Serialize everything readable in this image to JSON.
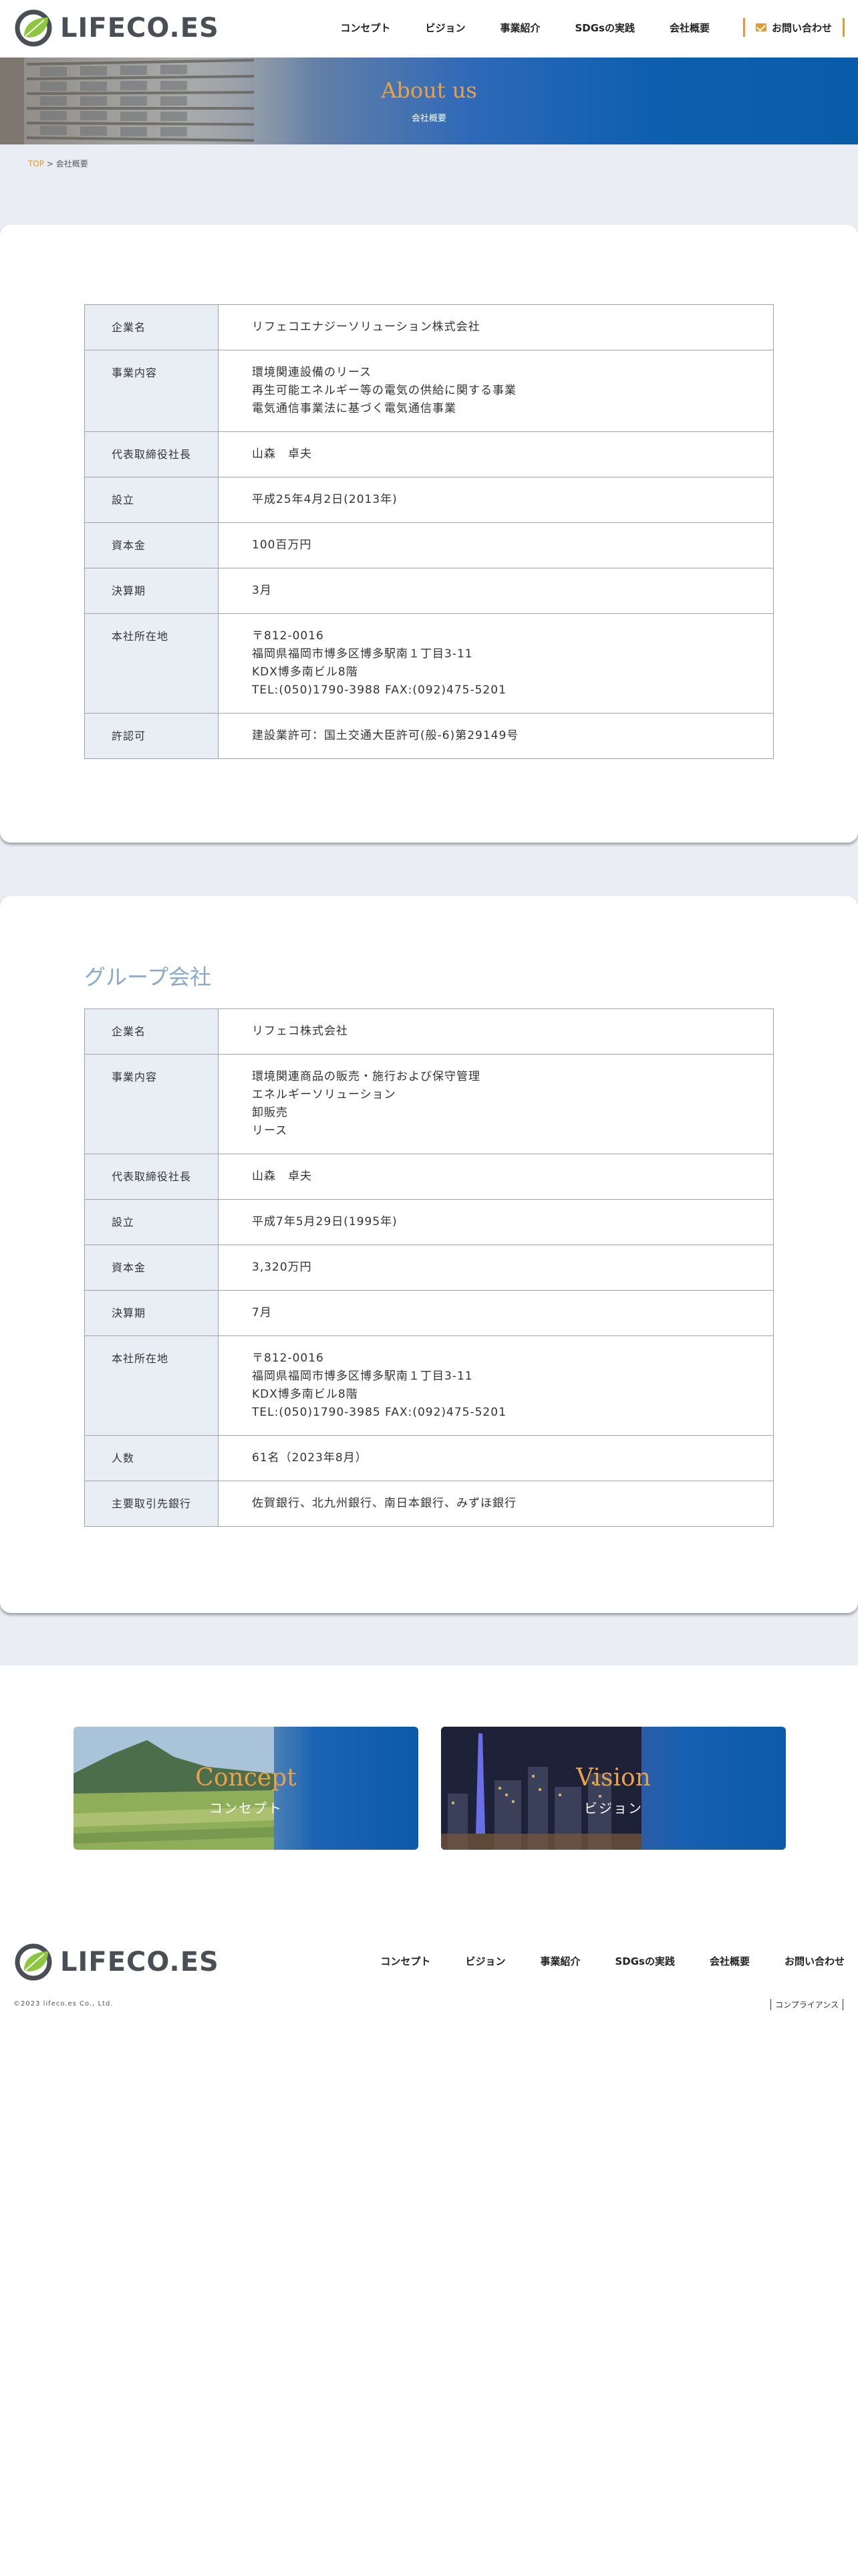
{
  "header": {
    "logo_text": "LIFECO.ES",
    "nav": [
      "コンセプト",
      "ビジョン",
      "事業紹介",
      "SDGsの実践",
      "会社概要"
    ],
    "contact_label": "お問い合わせ"
  },
  "hero": {
    "title": "About us",
    "subtitle": "会社概要"
  },
  "breadcrumb": {
    "top": "TOP",
    "separator": " > ",
    "current": "会社概要"
  },
  "company": {
    "rows": [
      {
        "label": "企業名",
        "value": "リフェコエナジーソリューション株式会社"
      },
      {
        "label": "事業内容",
        "value": [
          "環境関連設備のリース",
          "再生可能エネルギー等の電気の供給に関する事業",
          "電気通信事業法に基づく電気通信事業"
        ]
      },
      {
        "label": "代表取締役社長",
        "value": "山森　卓夫"
      },
      {
        "label": "設立",
        "value": "平成25年4月2日(2013年)"
      },
      {
        "label": "資本金",
        "value": "100百万円"
      },
      {
        "label": "決算期",
        "value": "3月"
      },
      {
        "label": "本社所在地",
        "value": [
          "〒812-0016",
          "福岡県福岡市博多区博多駅南１丁目3-11",
          "KDX博多南ビル8階",
          "TEL:(050)1790-3988 FAX:(092)475-5201"
        ]
      },
      {
        "label": "許認可",
        "value": "建設業許可：国土交通大臣許可(般-6)第29149号"
      }
    ]
  },
  "group": {
    "title": "グループ会社",
    "rows": [
      {
        "label": "企業名",
        "value": "リフェコ株式会社"
      },
      {
        "label": "事業内容",
        "value": [
          "環境関連商品の販売・施行および保守管理",
          "エネルギーソリューション",
          "卸販売",
          "リース"
        ]
      },
      {
        "label": "代表取締役社長",
        "value": "山森　卓夫"
      },
      {
        "label": "設立",
        "value": "平成7年5月29日(1995年)"
      },
      {
        "label": "資本金",
        "value": "3,320万円"
      },
      {
        "label": "決算期",
        "value": "7月"
      },
      {
        "label": "本社所在地",
        "value": [
          "〒812-0016",
          "福岡県福岡市博多区博多駅南１丁目3-11",
          "KDX博多南ビル8階",
          "TEL:(050)1790-3985 FAX:(092)475-5201"
        ]
      },
      {
        "label": "人数",
        "value": "61名（2023年8月）"
      },
      {
        "label": "主要取引先銀行",
        "value": "佐賀銀行、北九州銀行、南日本銀行、みずほ銀行"
      }
    ]
  },
  "banners": [
    {
      "title": "Concept",
      "subtitle": "コンセプト"
    },
    {
      "title": "Vision",
      "subtitle": "ビジョン"
    }
  ],
  "footer": {
    "logo_text": "LIFECO.ES",
    "nav": [
      "コンセプト",
      "ビジョン",
      "事業紹介",
      "SDGsの実践",
      "会社概要",
      "お問い合わせ"
    ],
    "copyright": "©2023 lifeco.es Co., Ltd.",
    "compliance": "コンプライアンス"
  },
  "colors": {
    "accent": "#e39a2e",
    "brand_blue": "#0c5aa9",
    "logo_green": "#8dc63f",
    "section_title": "#89a9c8",
    "page_bg": "#eaeef4"
  }
}
